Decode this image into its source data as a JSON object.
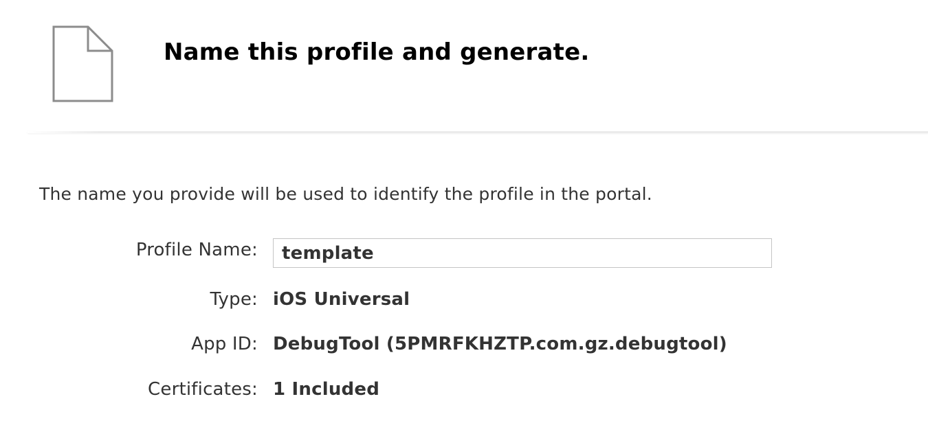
{
  "header": {
    "icon": "document-icon",
    "title": "Name this profile and generate."
  },
  "intro_text": "The name you provide will be used to identify the profile in the portal.",
  "form": {
    "profile_name": {
      "label": "Profile Name:",
      "value": "template"
    },
    "type": {
      "label": "Type:",
      "value": "iOS Universal"
    },
    "app_id": {
      "label": "App ID:",
      "value": "DebugTool (5PMRFKHZTP.com.gz.debugtool)"
    },
    "certificates": {
      "label": "Certificates:",
      "value": "1 Included"
    }
  },
  "colors": {
    "title": "#000000",
    "text": "#333333",
    "input_border": "#c4c4c4",
    "divider": "#ebebeb",
    "icon_stroke": "#8c8c8c"
  }
}
